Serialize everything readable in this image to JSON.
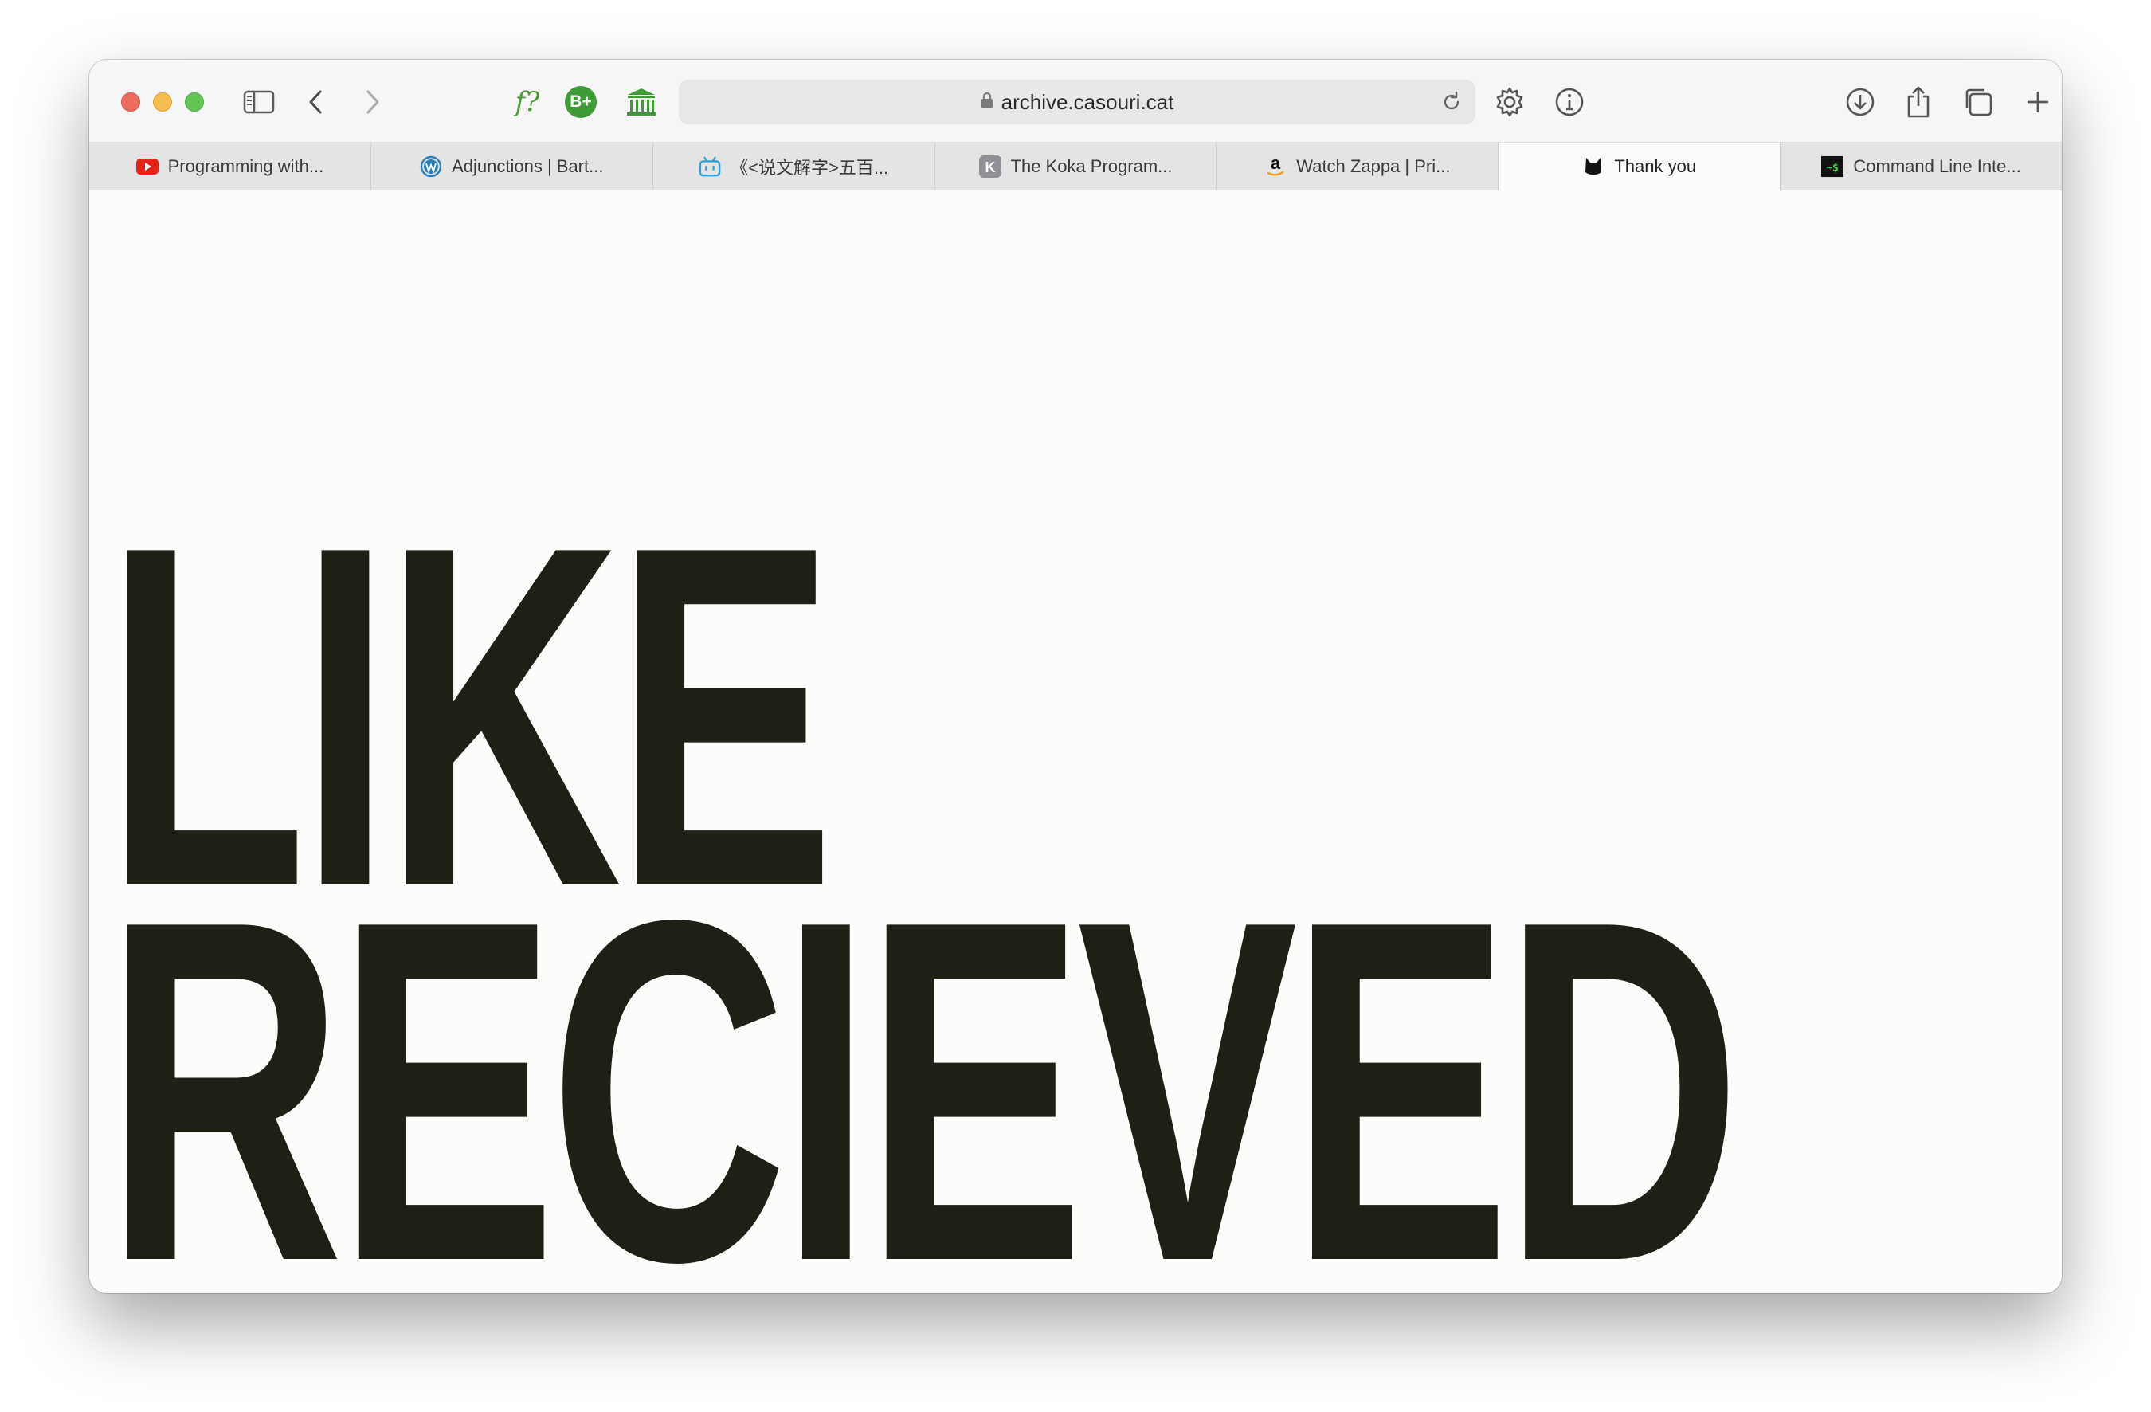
{
  "browser": {
    "url": "archive.casouri.cat",
    "extensions": [
      {
        "name": "footnote-extension",
        "label": "f?"
      },
      {
        "name": "bplus-extension",
        "label": "B+"
      },
      {
        "name": "library-extension",
        "label": ""
      }
    ],
    "tabs": [
      {
        "label": "Programming with...",
        "icon": "youtube-icon",
        "active": false
      },
      {
        "label": "Adjunctions |  Bart...",
        "icon": "wordpress-icon",
        "active": false
      },
      {
        "label": "《<说文解字>五百...",
        "icon": "bilibili-icon",
        "active": false
      },
      {
        "label": "The Koka Program...",
        "icon": "k-icon",
        "active": false
      },
      {
        "label": "Watch Zappa | Pri...",
        "icon": "amazon-icon",
        "active": false
      },
      {
        "label": "Thank you",
        "icon": "cat-icon",
        "active": true
      },
      {
        "label": "Command Line Inte...",
        "icon": "terminal-icon",
        "active": false
      }
    ]
  },
  "page": {
    "line1": "LIKE",
    "line2": "RECIEVED"
  },
  "colors": {
    "headline": "#1f2015",
    "background": "#fcfcfa"
  }
}
